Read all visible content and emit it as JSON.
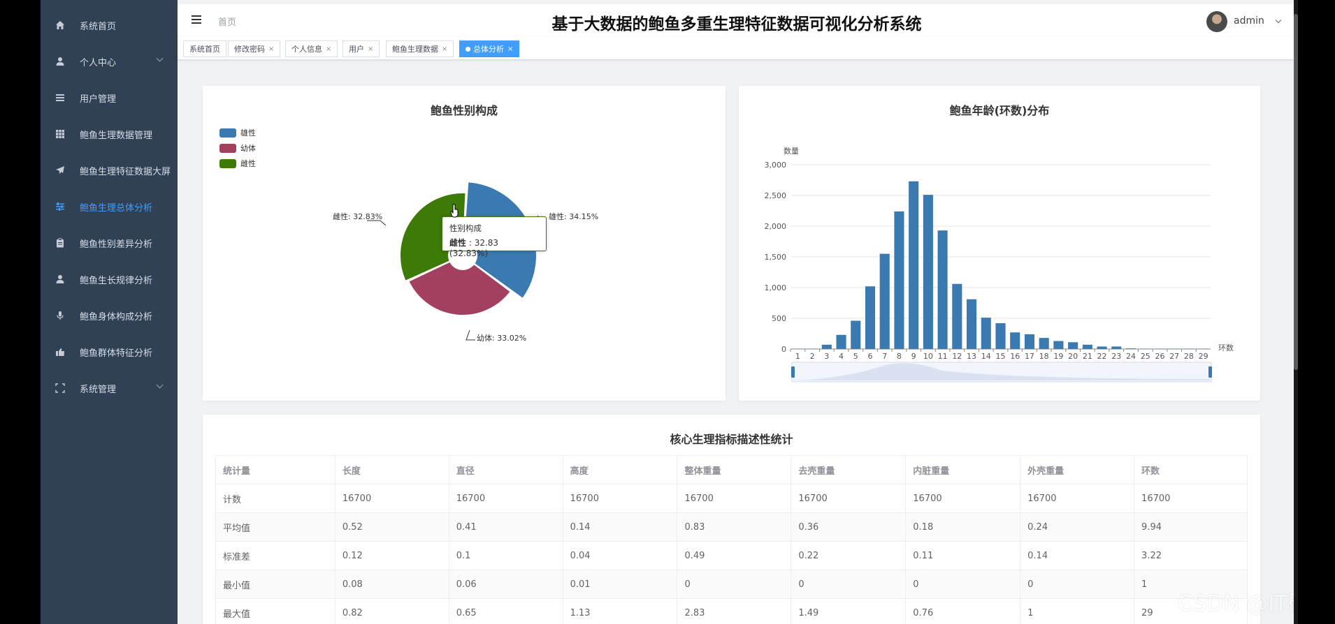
{
  "app": {
    "title": "基于大数据的鲍鱼多重生理特征数据可视化分析系统",
    "breadcrumb": "首页",
    "user": "admin"
  },
  "sidebar": {
    "items": [
      {
        "label": "系统首页",
        "icon": "home-icon"
      },
      {
        "label": "个人中心",
        "icon": "user-icon"
      },
      {
        "label": "用户管理",
        "icon": "list-icon"
      },
      {
        "label": "鲍鱼生理数据管理",
        "icon": "grid-icon"
      },
      {
        "label": "鲍鱼生理特征数据大屏",
        "icon": "send-icon"
      },
      {
        "label": "鲍鱼生理总体分析",
        "icon": "sliders-icon"
      },
      {
        "label": "鲍鱼性别差异分析",
        "icon": "clipboard-icon"
      },
      {
        "label": "鲍鱼生长规律分析",
        "icon": "user-icon"
      },
      {
        "label": "鲍鱼身体构成分析",
        "icon": "mic-icon"
      },
      {
        "label": "鲍鱼群体特征分析",
        "icon": "hand-icon"
      },
      {
        "label": "系统管理",
        "icon": "expand-icon"
      }
    ],
    "active_index": 5
  },
  "tags": [
    "系统首页",
    "修改密码",
    "个人信息",
    "用户",
    "鲍鱼生理数据",
    "总体分析"
  ],
  "tag_close": "×",
  "colors": {
    "sidebar": "#304156",
    "accent": "#409eff",
    "male": "#3a7ab0",
    "juvenile": "#a3405f",
    "female": "#3e7a07",
    "bar": "#3a7ab0"
  },
  "pie": {
    "title": "鲍鱼性别构成",
    "legend": [
      "雄性",
      "幼体",
      "雌性"
    ],
    "labels": [
      "雄性: 34.15%",
      "幼体: 33.02%",
      "雌性: 32.83%"
    ],
    "tooltip": {
      "title": "性别构成",
      "name": "雌性",
      "sep": " : ",
      "value": "32.83 (32.83%)"
    }
  },
  "bar": {
    "title": "鲍鱼年龄(环数)分布",
    "ylabel": "数量",
    "xlabel": "环数"
  },
  "chart_data": [
    {
      "type": "pie",
      "title": "鲍鱼性别构成",
      "categories": [
        "雄性",
        "幼体",
        "雌性"
      ],
      "values": [
        34.15,
        33.02,
        32.83
      ],
      "legend": "top-left"
    },
    {
      "type": "bar",
      "title": "鲍鱼年龄(环数)分布",
      "xlabel": "环数",
      "ylabel": "数量",
      "categories": [
        "1",
        "2",
        "3",
        "4",
        "5",
        "6",
        "7",
        "8",
        "9",
        "10",
        "11",
        "12",
        "13",
        "14",
        "15",
        "16",
        "17",
        "18",
        "19",
        "20",
        "21",
        "22",
        "23",
        "24",
        "25",
        "26",
        "27",
        "28",
        "29"
      ],
      "values": [
        3,
        5,
        70,
        230,
        460,
        1020,
        1550,
        2240,
        2730,
        2510,
        1930,
        1060,
        810,
        510,
        420,
        270,
        240,
        180,
        130,
        110,
        70,
        40,
        40,
        10,
        5,
        5,
        5,
        5,
        5
      ],
      "yticks": [
        "0",
        "500",
        "1,000",
        "1,500",
        "2,000",
        "2,500",
        "3,000"
      ],
      "ylim": [
        0,
        3000
      ],
      "grid": true
    }
  ],
  "stats": {
    "title": "核心生理指标描述性统计",
    "headers": [
      "统计量",
      "长度",
      "直径",
      "高度",
      "整体重量",
      "去壳重量",
      "内脏重量",
      "外壳重量",
      "环数"
    ],
    "rows": [
      [
        "计数",
        "16700",
        "16700",
        "16700",
        "16700",
        "16700",
        "16700",
        "16700",
        "16700"
      ],
      [
        "平均值",
        "0.52",
        "0.41",
        "0.14",
        "0.83",
        "0.36",
        "0.18",
        "0.24",
        "9.94"
      ],
      [
        "标准差",
        "0.12",
        "0.1",
        "0.04",
        "0.49",
        "0.22",
        "0.11",
        "0.14",
        "3.22"
      ],
      [
        "最小值",
        "0.08",
        "0.06",
        "0.01",
        "0",
        "0",
        "0",
        "0",
        "1"
      ],
      [
        "最大值",
        "0.82",
        "0.65",
        "1.13",
        "2.83",
        "1.49",
        "0.76",
        "1",
        "29"
      ]
    ]
  },
  "watermark": "CSDN @IT研究室"
}
